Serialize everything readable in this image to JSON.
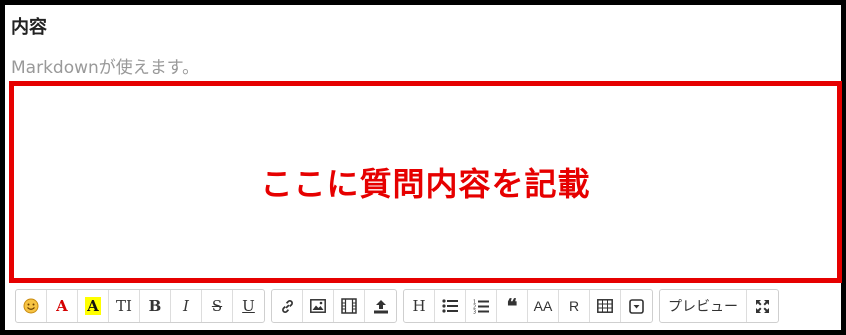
{
  "field": {
    "label": "内容",
    "hint": "Markdownが使えます。",
    "note": "ここに質問内容を記載"
  },
  "colors": {
    "highlight": "#e60000",
    "frame": "#000000"
  },
  "toolbar": {
    "emoji_icon": "smiley-icon",
    "font_color": "A",
    "bg_color": "A",
    "text_size": "TI",
    "bold": "B",
    "italic": "I",
    "strike": "S",
    "underline": "U",
    "link_icon": "link-icon",
    "image_icon": "image-icon",
    "video_icon": "film-icon",
    "upload_icon": "upload-icon",
    "heading": "H",
    "bullet_icon": "bulleted-list-icon",
    "numbered_icon": "numbered-list-icon",
    "quote": "❝",
    "acronym": "AA",
    "ruby": "R",
    "table_icon": "table-icon",
    "collapse_icon": "chevron-box-icon",
    "preview": "プレビュー",
    "fullscreen_icon": "expand-arrows-icon"
  }
}
